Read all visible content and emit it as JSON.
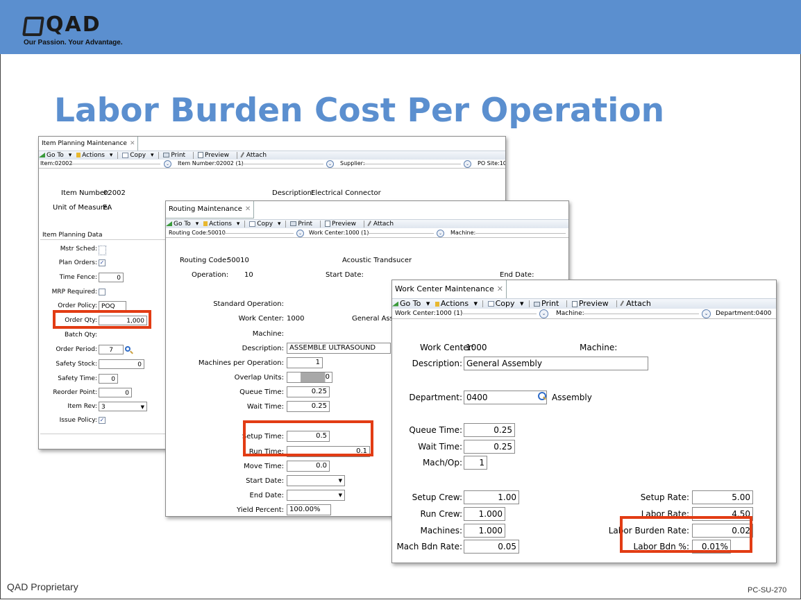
{
  "slide": {
    "logo_text": "QAD",
    "tagline": "Our Passion. Your Advantage.",
    "title": "Labor Burden Cost Per Operation",
    "footer_left": "QAD Proprietary",
    "footer_right": "PC-SU-270",
    "accent_color": "#5b8fcf",
    "highlight_color": "#e23c14"
  },
  "toolbar": {
    "goto": "Go To",
    "actions": "Actions",
    "copy": "Copy",
    "print": "Print",
    "preview": "Preview",
    "attach": "Attach"
  },
  "item_planning": {
    "tab": "Item Planning Maintenance",
    "nav": [
      "Item:02002",
      "Item Number:02002 (1)",
      "Supplier:",
      "PO Site:10"
    ],
    "item_number_label": "Item Number:",
    "item_number": "02002",
    "description_label": "Description:",
    "description": "Electrical Connector",
    "uom_label": "Unit of Measure:",
    "uom": "EA",
    "section": "Item Planning Data",
    "mstr_sched_label": "Mstr Sched:",
    "plan_orders_label": "Plan Orders:",
    "time_fence_label": "Time Fence:",
    "time_fence": "0",
    "mrp_required_label": "MRP Required:",
    "order_policy_label": "Order Policy:",
    "order_policy": "POQ",
    "order_qty_label": "Order Qty:",
    "order_qty": "1,000",
    "batch_qty_label": "Batch Qty:",
    "order_period_label": "Order Period:",
    "order_period": "7",
    "safety_stock_label": "Safety Stock:",
    "safety_stock": "0",
    "safety_time_label": "Safety Time:",
    "safety_time": "0",
    "reorder_point_label": "Reorder Point:",
    "reorder_point": "0",
    "item_rev_label": "Item Rev:",
    "item_rev": "3",
    "issue_policy_label": "Issue Policy:"
  },
  "routing": {
    "tab": "Routing Maintenance",
    "nav": [
      "Routing Code:50010",
      "Work Center:1000 (1)",
      "Machine:"
    ],
    "routing_code_label": "Routing Code:",
    "routing_code": "50010",
    "item_desc": "Acoustic Trandsucer",
    "operation_label": "Operation:",
    "operation": "10",
    "start_date_label": "Start Date:",
    "end_date_label": "End Date:",
    "std_op_label": "Standard Operation:",
    "work_center_label": "Work Center:",
    "work_center": "1000",
    "wc_desc": "General Asse",
    "machine_label": "Machine:",
    "description_label": "Description:",
    "description": "ASSEMBLE ULTRASOUND",
    "machines_per_op_label": "Machines per Operation:",
    "machines_per_op": "1",
    "overlap_units_label": "Overlap Units:",
    "overlap_units": "0",
    "queue_time_label": "Queue Time:",
    "queue_time": "0.25",
    "wait_time_label": "Wait Time:",
    "wait_time": "0.25",
    "setup_time_label": "Setup Time:",
    "setup_time": "0.5",
    "run_time_label": "Run Time:",
    "run_time": "0.1",
    "move_time_label": "Move Time:",
    "move_time": "0.0",
    "start_date2_label": "Start Date:",
    "end_date2_label": "End Date:",
    "yield_label": "Yield Percent:",
    "yield": "100.00%"
  },
  "work_center": {
    "tab": "Work Center Maintenance",
    "nav": [
      "Work Center:1000 (1)",
      "Machine:",
      "Department:0400"
    ],
    "wc_label": "Work Center:",
    "wc": "1000",
    "machine_label": "Machine:",
    "description_label": "Description:",
    "description": "General Assembly",
    "department_label": "Department:",
    "department": "0400",
    "department_name": "Assembly",
    "queue_time_label": "Queue Time:",
    "queue_time": "0.25",
    "wait_time_label": "Wait Time:",
    "wait_time": "0.25",
    "mach_op_label": "Mach/Op:",
    "mach_op": "1",
    "setup_crew_label": "Setup Crew:",
    "setup_crew": "1.00",
    "run_crew_label": "Run Crew:",
    "run_crew": "1.000",
    "machines_label": "Machines:",
    "machines": "1.000",
    "mach_bdn_rate_label": "Mach Bdn Rate:",
    "mach_bdn_rate": "0.05",
    "setup_rate_label": "Setup Rate:",
    "setup_rate": "5.00",
    "labor_rate_label": "Labor Rate:",
    "labor_rate": "4.50",
    "labor_burden_rate_label": "Labor Burden Rate:",
    "labor_burden_rate": "0.02",
    "labor_bdn_pct_label": "Labor Bdn %:",
    "labor_bdn_pct": "0.01%"
  }
}
